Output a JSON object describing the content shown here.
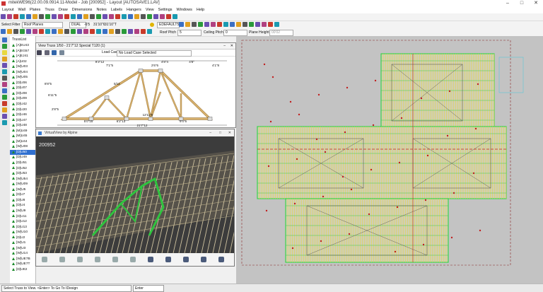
{
  "window": {
    "title": "mitekWE96(22.00.09.0914.11-Model - Job [200952] - Layout [AUTOSAVE1.LAV]"
  },
  "menu": [
    "Layout",
    "Wall",
    "Plates",
    "Truss",
    "Draw",
    "Dimensions",
    "Notes",
    "Labels",
    "Hangers",
    "View",
    "Settings",
    "Windows",
    "Help"
  ],
  "toolbar": {
    "select_filter_label": "Select Filter",
    "select_filter_value": "Roof Planes",
    "level_value": "DUAL",
    "dim1_value": "-6'5",
    "dim2_value": "31'10\"6",
    "dim3_value": "31'10\"T",
    "layer_value": "EDEFAULT5",
    "roof_pitch_label": "Roof Pitch",
    "roof_pitch_value": "5",
    "ceiling_pitch_label": "Ceiling Pitch",
    "ceiling_pitch_value": "0",
    "plane_height_label": "Plane Height",
    "plane_height_value": "00'02"
  },
  "truss_list": {
    "header": "TrussList",
    "selected_index": 20,
    "items": [
      "[A]EU43",
      "[A]EG57",
      "[A]EJ41",
      "[A]U02",
      "[W]U03",
      "[W]U04",
      "[W]U05",
      "[D]U06",
      "[D]U07",
      "[D]U08",
      "[D]U09",
      "[D]U42",
      "[D]U20",
      "[D]U46",
      "[D]U47",
      "[D]U48",
      "[M]U49",
      "[M]U45",
      "[M]U44",
      "[W]U08",
      "[D]U50",
      "[D]U49",
      "[D]U51",
      "[D]U52",
      "[D]U53",
      "[W]U54",
      "[W]U09",
      "[W]U5",
      "[D]U7",
      "[D]U8",
      "[D]U4",
      "[W]U9",
      "[D]U11",
      "[D]U12",
      "[D]U13",
      "[W]U10",
      "[D]U2",
      "[W]U1",
      "[W]U3",
      "[W]U14",
      "[W]UE7B",
      "[W]UE7T",
      "[D]UE2"
    ]
  },
  "view_truss": {
    "title": "View Truss  1/50 - 21'7\"12  Special T120 (1)",
    "load_case_label": "Load Case",
    "load_case_value": "No Load Case Selected",
    "dims_top": [
      "9'3\"12",
      "7'1\"5",
      "4'8\"4",
      "2'6\"6",
      "4'8\"",
      "4'1\"8"
    ],
    "dims_bottom": [
      "5'0\"15",
      "6'2\"13",
      "9'4\"6",
      "12'11\"8",
      "21'7\"12"
    ],
    "left_heights": [
      "8'8\"5",
      "6'11\"5",
      "2'8\"5"
    ],
    "pitch": "5/12"
  },
  "virtual_view": {
    "title": "VirtualView by Alpine",
    "job": "200952"
  },
  "status": {
    "message": "Select Truss to View. <Enter> To Go To IDesign",
    "entry_label": "Enter"
  },
  "colors": {
    "plan_bg": "#c3c3c3",
    "truss_yellow": "#e6d64a",
    "truss_green": "#3bd44b",
    "plate_red": "#c02020",
    "selection_blue": "#2f6fd0"
  }
}
